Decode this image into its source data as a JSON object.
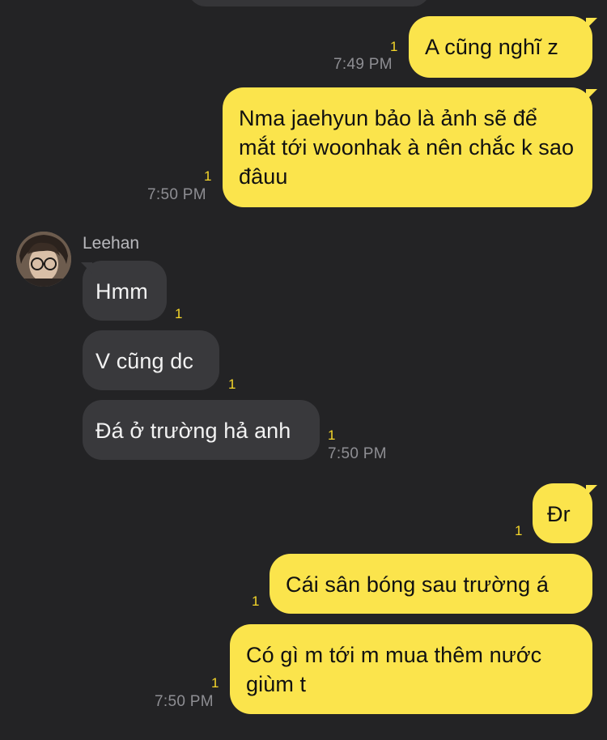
{
  "conversation": {
    "messages": [
      {
        "from": "me",
        "text": "A cũng nghĩ z",
        "unread": "1",
        "time": "7:49 PM"
      },
      {
        "from": "me",
        "text": "Nma jaehyun bảo là ảnh sẽ để mắt tới woonhak à nên chắc k sao đâuu",
        "unread": "1",
        "time": "7:50 PM"
      },
      {
        "from": "them",
        "sender": "Leehan",
        "text": "Hmm",
        "unread": "1"
      },
      {
        "from": "them",
        "text": "V cũng dc",
        "unread": "1"
      },
      {
        "from": "them",
        "text": "Đá ở trường hả anh",
        "unread": "1",
        "time": "7:50 PM"
      },
      {
        "from": "me",
        "text": "Đr",
        "unread": "1"
      },
      {
        "from": "me",
        "text": "Cái sân bóng sau trường á",
        "unread": "1"
      },
      {
        "from": "me",
        "text": "Có gì m tới m mua thêm nước giùm t",
        "unread": "1",
        "time": "7:50 PM"
      }
    ]
  },
  "colors": {
    "background": "#232325",
    "outgoing_bubble": "#fbe44c",
    "incoming_bubble": "#39393c",
    "unread_count": "#f5d62a",
    "timestamp": "#8e8e93"
  },
  "icons": {
    "avatar": "contact-avatar-photo"
  }
}
